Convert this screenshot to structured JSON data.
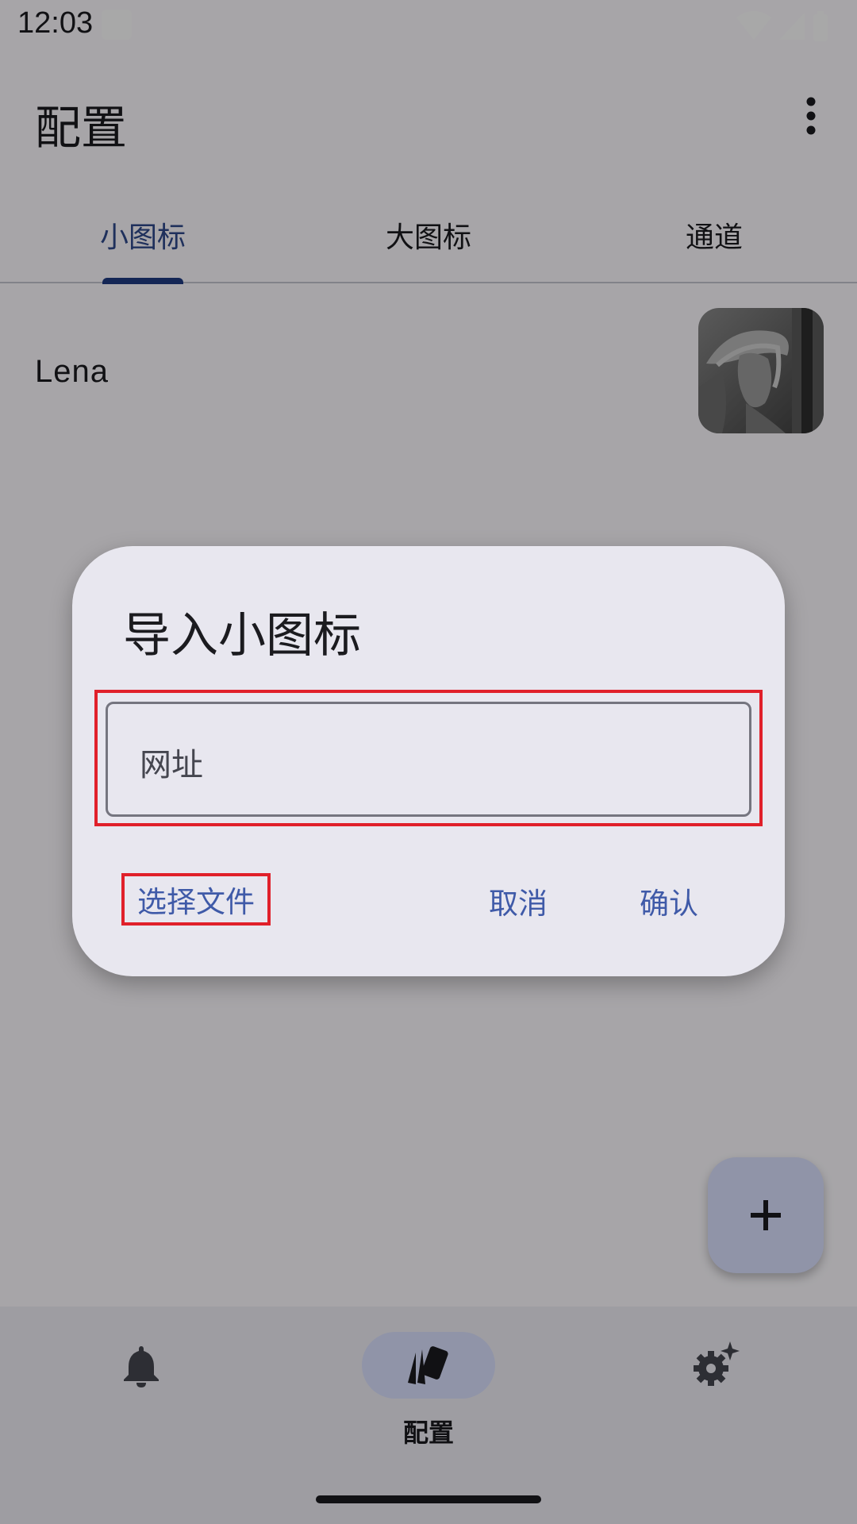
{
  "status_bar": {
    "time": "12:03",
    "icons": [
      "notification-square-icon",
      "wifi-icon",
      "signal-icon",
      "battery-icon"
    ]
  },
  "app_bar": {
    "title": "配置",
    "menu_icon": "more-vert-icon"
  },
  "tabs": [
    {
      "label": "小图标",
      "active": true
    },
    {
      "label": "大图标",
      "active": false
    },
    {
      "label": "通道",
      "active": false
    }
  ],
  "list": {
    "items": [
      {
        "label": "Lena",
        "thumbnail": "portrait-image"
      }
    ]
  },
  "fab": {
    "icon": "plus-icon"
  },
  "dialog": {
    "title": "导入小图标",
    "url_placeholder": "网址",
    "choose_file_label": "选择文件",
    "cancel_label": "取消",
    "confirm_label": "确认"
  },
  "bottom_nav": {
    "items": [
      {
        "icon": "bell-icon",
        "label": "",
        "active": false
      },
      {
        "icon": "cards-icon",
        "label": "配置",
        "active": true
      },
      {
        "icon": "settings-sparkle-icon",
        "label": "",
        "active": false
      }
    ]
  },
  "colors": {
    "accent": "#3f5aa8",
    "tab_indicator": "#1f3a82",
    "highlight": "#e0202a",
    "dialog_bg": "#e8e7ef",
    "fab_bg": "#dbe1ff"
  }
}
